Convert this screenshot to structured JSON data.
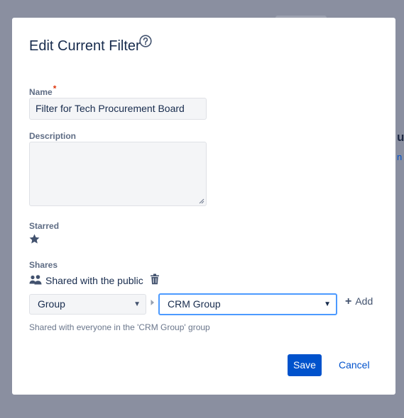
{
  "background": {
    "partial_heading": "u",
    "partial_link": "n"
  },
  "dialog": {
    "title": "Edit Current Filter",
    "help_icon": "question-circle-icon",
    "fields": {
      "name_label": "Name",
      "required_marker": "*",
      "name_value": "Filter for Tech Procurement Board",
      "description_label": "Description",
      "description_value": "",
      "starred_label": "Starred",
      "star_icon": "star-filled-icon"
    },
    "shares": {
      "label": "Shares",
      "shared_with": "Shared with the public",
      "share_type_selected": "Group",
      "group_selected": "CRM Group",
      "add_label": "Add",
      "add_plus": "+",
      "hint": "Shared with everyone in the 'CRM Group' group"
    },
    "actions": {
      "save": "Save",
      "cancel": "Cancel"
    }
  },
  "colors": {
    "overlay": "#8a8fa0",
    "primary": "#0052cc",
    "focus_border": "#4c9aff",
    "required": "#de350b",
    "text": "#172b4d",
    "label": "#5e6c84"
  }
}
